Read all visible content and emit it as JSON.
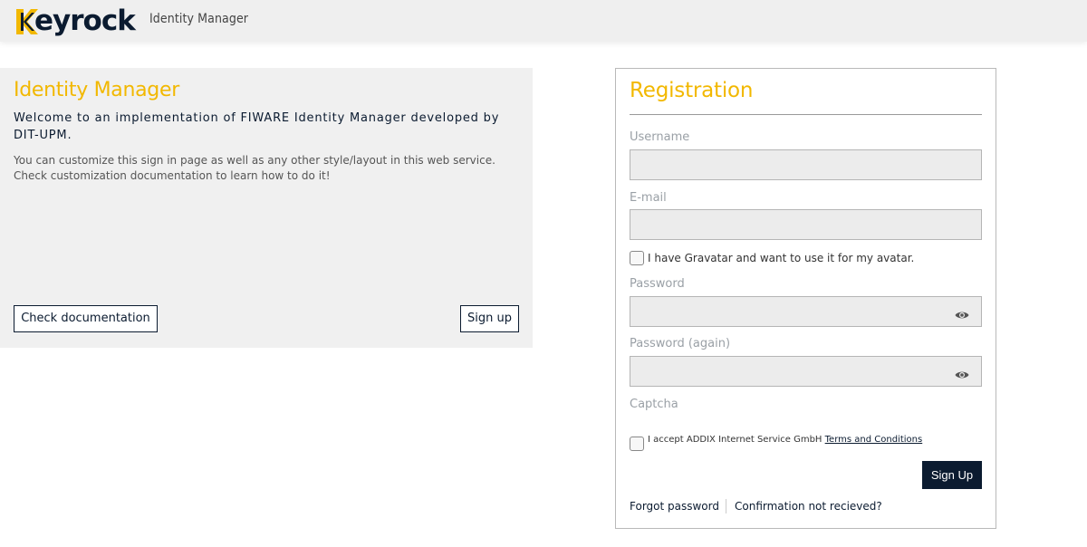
{
  "header": {
    "logo_text": "eyrock",
    "logo_letter": "K",
    "app_title": "Identity Manager"
  },
  "info": {
    "title": "Identity Manager",
    "welcome": "Welcome to an implementation of FIWARE Identity Manager developed by DIT-UPM.",
    "description": "You can customize this sign in page as well as any other style/layout in this web service. Check customization documentation to learn how to do it!",
    "doc_button": "Check documentation",
    "signup_button": "Sign up"
  },
  "registration": {
    "title": "Registration",
    "username_label": "Username",
    "email_label": "E-mail",
    "gravatar_label": "I have Gravatar and want to use it for my avatar.",
    "password_label": "Password",
    "password_again_label": "Password (again)",
    "captcha_label": "Captcha",
    "terms_prefix": "I accept ADDIX Internet Service GmbH",
    "terms_link": "Terms and Conditions",
    "submit_label": "Sign Up",
    "forgot_password": "Forgot password",
    "confirmation": "Confirmation not recieved?"
  },
  "colors": {
    "accent": "#f2b800",
    "navy": "#0b1b30"
  }
}
